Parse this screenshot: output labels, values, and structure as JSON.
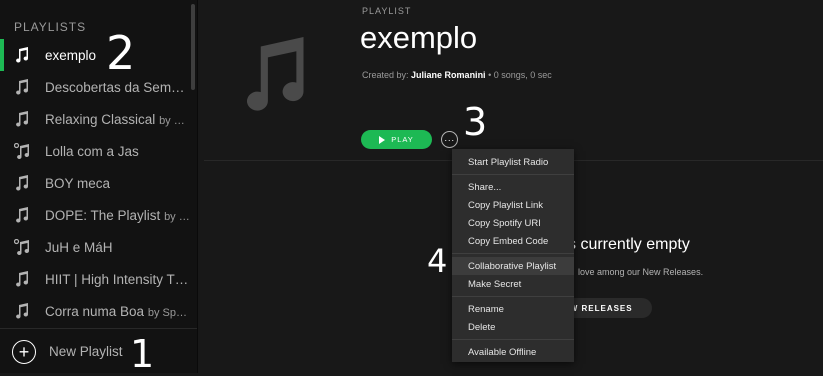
{
  "sidebar": {
    "title": "PLAYLISTS",
    "items": [
      {
        "label": "exemplo",
        "by": "",
        "icon": "music-note-icon",
        "active": true
      },
      {
        "label": "Descobertas da Sem…",
        "by": "",
        "icon": "music-note-icon"
      },
      {
        "label": "Relaxing Classical",
        "by": "by …",
        "icon": "music-note-icon"
      },
      {
        "label": "Lolla com a Jas",
        "by": "",
        "icon": "collaborative-music-icon"
      },
      {
        "label": "BOY meca",
        "by": "",
        "icon": "music-note-icon"
      },
      {
        "label": "DOPE: The Playlist",
        "by": "by …",
        "icon": "music-note-icon"
      },
      {
        "label": "JuH e MáH",
        "by": "",
        "icon": "collaborative-music-icon"
      },
      {
        "label": "HIIT | High Intensity T…",
        "by": "",
        "icon": "music-note-icon"
      },
      {
        "label": "Corra numa Boa",
        "by": "by Sp…",
        "icon": "music-note-icon"
      }
    ],
    "new_playlist_label": "New Playlist"
  },
  "header": {
    "type_label": "PLAYLIST",
    "title": "exemplo",
    "created_by_prefix": "Created by:",
    "owner": "Juliane Romanini",
    "stats": "• 0 songs, 0 sec",
    "play_label": "PLAY",
    "more_label": "···"
  },
  "empty_state": {
    "title": "s currently empty",
    "subtitle": "love among our New Releases.",
    "button_label": "EW RELEASES"
  },
  "context_menu": {
    "items": [
      {
        "label": "Start Playlist Radio"
      },
      {
        "label": "Share..."
      },
      {
        "label": "Copy Playlist Link"
      },
      {
        "label": "Copy Spotify URI"
      },
      {
        "label": "Copy Embed Code"
      },
      {
        "label": "Collaborative Playlist"
      },
      {
        "label": "Make Secret"
      },
      {
        "label": "Rename"
      },
      {
        "label": "Delete"
      },
      {
        "label": "Available Offline"
      }
    ]
  },
  "annotations": {
    "one": "1",
    "two": "2",
    "three": "3",
    "four": "4"
  },
  "colors": {
    "accent": "#1db954",
    "background": "#181818",
    "sidebar": "#121212",
    "menu": "#2d2d2d"
  }
}
